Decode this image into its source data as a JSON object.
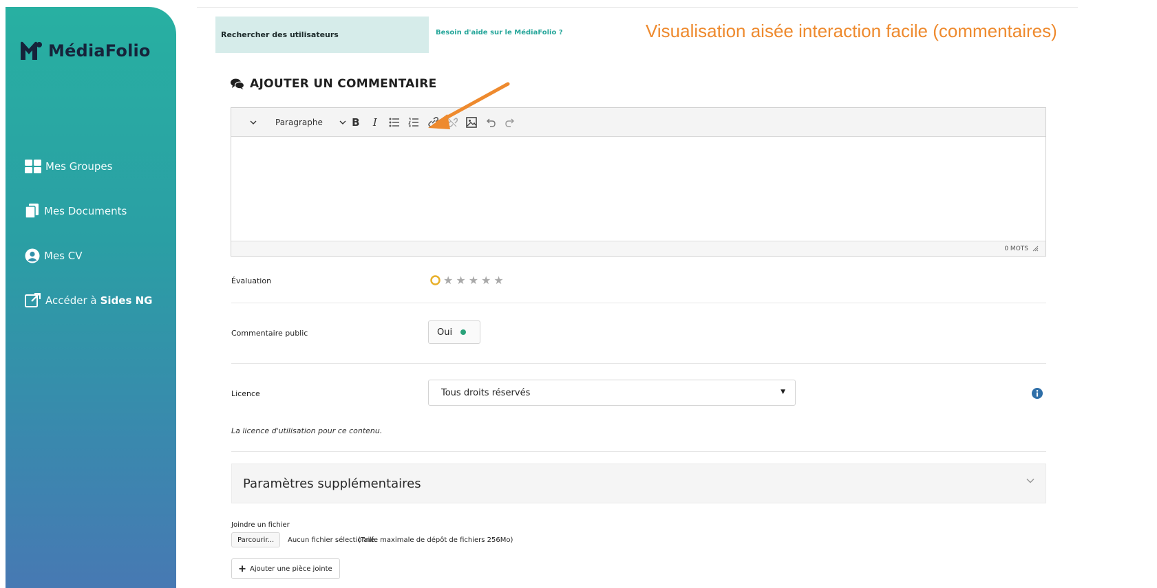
{
  "sidebar": {
    "brand": "MédiaFolio",
    "items": [
      {
        "label": "Mes Groupes"
      },
      {
        "label": "Mes Documents"
      },
      {
        "label": "Mes CV"
      },
      {
        "label": "Accéder à",
        "strong": "Sides NG"
      }
    ]
  },
  "header": {
    "search_tab": "Rechercher des utilisateurs",
    "help_link": "Besoin d'aide sur le MédiaFolio ?",
    "annotation": "Visualisation aisée interaction facile (commentaires)"
  },
  "comment": {
    "title": "AJOUTER UN COMMENTAIRE",
    "toolbar": {
      "paragraph": "Paragraphe",
      "bold": "B",
      "italic": "I"
    },
    "status": "0 MOTS"
  },
  "form": {
    "evaluation_label": "Évaluation",
    "public_label": "Commentaire public",
    "public_value": "Oui",
    "licence_label": "Licence",
    "licence_value": "Tous droits réservés",
    "licence_help": "La licence d'utilisation pour ce contenu.",
    "extra_params": "Paramètres supplémentaires",
    "attach_label": "Joindre un fichier",
    "browse": "Parcourir...",
    "no_file": "Aucun fichier sélectionné.",
    "max_size": "(Taille maximale de dépôt de fichiers 256Mo)",
    "add_attachment": "Ajouter une pièce jointe"
  },
  "colors": {
    "accent": "#26a69a",
    "annotation": "#ee8a2e",
    "sidebar_top": "#28b0a2",
    "sidebar_bottom": "#4779b3"
  }
}
